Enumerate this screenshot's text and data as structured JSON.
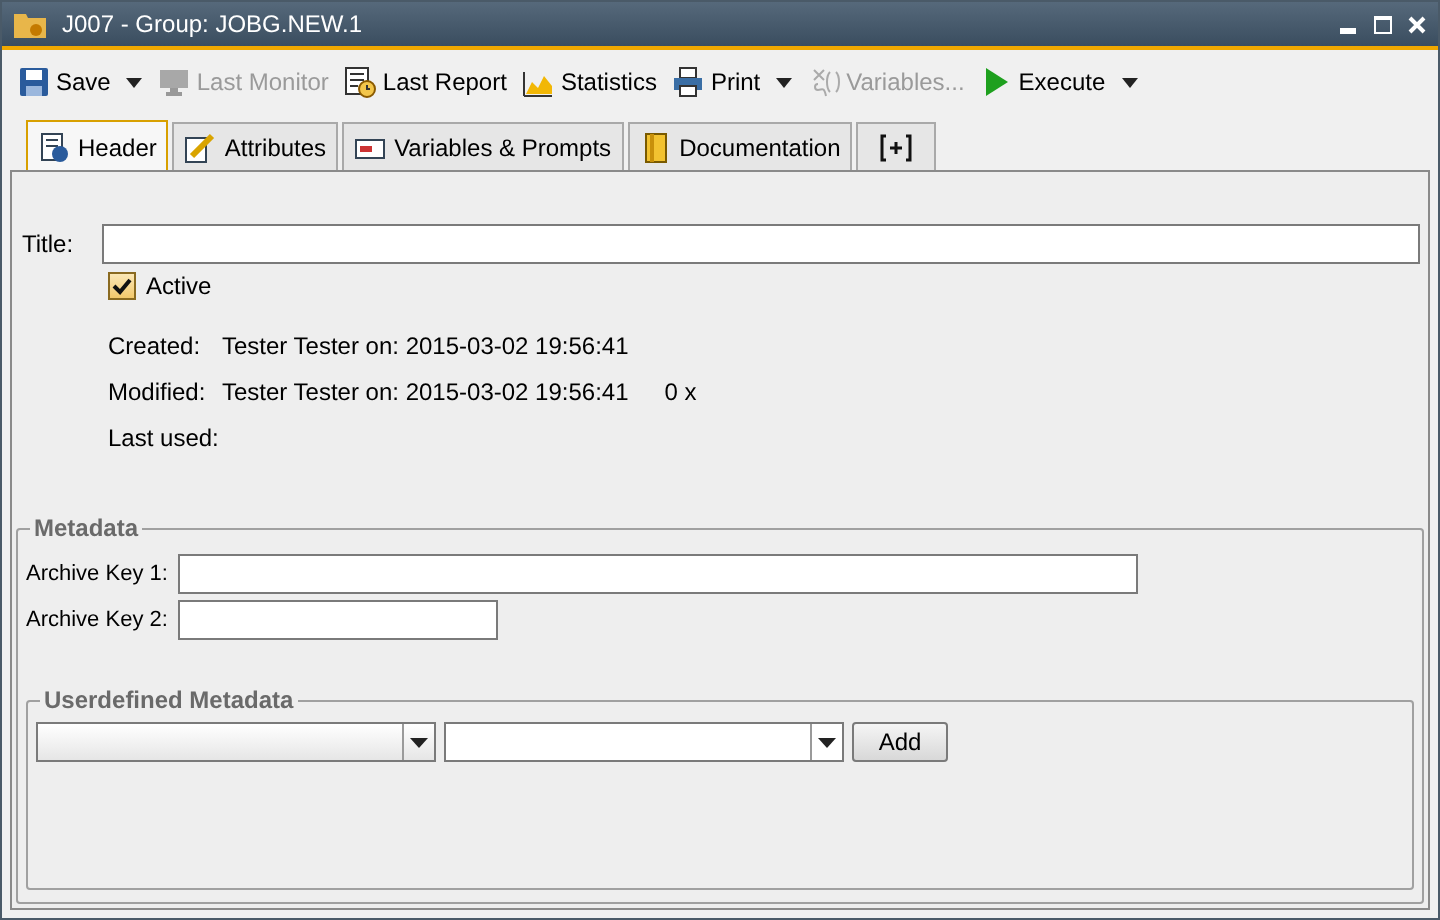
{
  "window": {
    "title": "J007 - Group: JOBG.NEW.1"
  },
  "toolbar": [
    {
      "label": "Save",
      "disabled": false,
      "dropdown": true
    },
    {
      "label": "Last Monitor",
      "disabled": true,
      "dropdown": false
    },
    {
      "label": "Last Report",
      "disabled": false,
      "dropdown": false
    },
    {
      "label": "Statistics",
      "disabled": false,
      "dropdown": false
    },
    {
      "label": "Print",
      "disabled": false,
      "dropdown": true
    },
    {
      "label": "Variables...",
      "disabled": true,
      "dropdown": false
    },
    {
      "label": "Execute",
      "disabled": false,
      "dropdown": true
    }
  ],
  "tabs": [
    {
      "kind": "text",
      "label": "Header",
      "selected": true
    },
    {
      "kind": "text",
      "label": "Attributes",
      "selected": false
    },
    {
      "kind": "text",
      "label": "Variables & Prompts",
      "selected": false
    },
    {
      "kind": "text",
      "label": "Documentation",
      "selected": false
    },
    {
      "kind": "add",
      "selected": false
    }
  ],
  "header": {
    "title_label": "Title:",
    "active": {
      "label": "Active",
      "checked": true
    },
    "info": [
      {
        "label": "Created:",
        "value": "Tester Tester on: 2015-03-02 19:56:41"
      },
      {
        "label": "Modified:",
        "value": "Tester Tester on: 2015-03-02 19:56:41",
        "extra": "0 x"
      },
      {
        "label": "Last used:"
      }
    ]
  },
  "metadata": {
    "title": "Metadata",
    "fields": [
      {
        "label": "Archive Key 1:"
      },
      {
        "label": "Archive Key 2:"
      }
    ],
    "userdefined": {
      "title": "Userdefined Metadata",
      "button": "Add"
    }
  }
}
